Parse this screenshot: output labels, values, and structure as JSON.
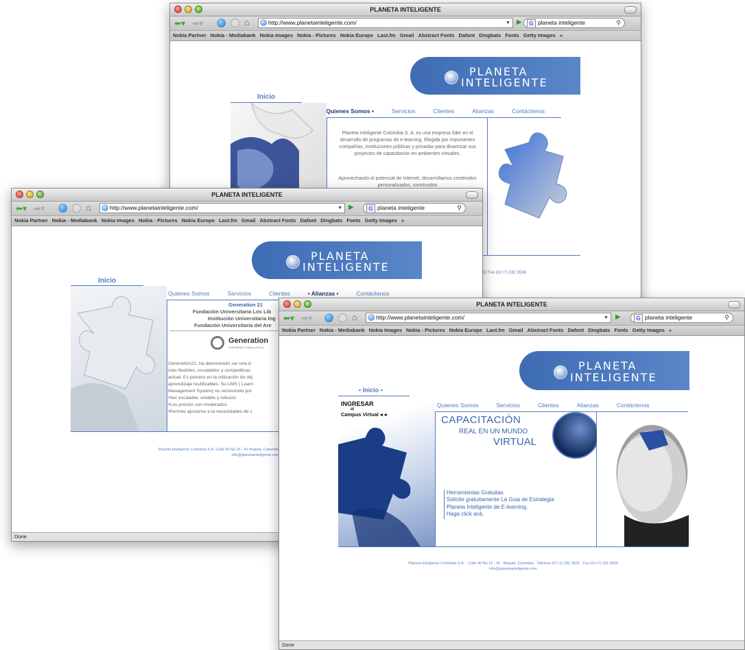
{
  "browser": {
    "window_title": "PLANETA INTELIGENTE",
    "url": "http://www.planetainteligente.com/",
    "search_text": "planeta inteligente",
    "status": "Done",
    "bookmarks": [
      "Nokia Partner",
      "Nokia - Mediabank",
      "Nokia Images",
      "Nokia - Pictures",
      "Nokia Europe",
      "Last.fm",
      "Gmail",
      "Abstract Fonts",
      "Dafont",
      "Dingbats",
      "Fonts",
      "Getty Images"
    ],
    "bookmarks_overflow": "»"
  },
  "site": {
    "logo_line1": "PLANETA",
    "logo_line2": "NTELIGENTE",
    "logo_initial": "I",
    "tab_inicio": "Inicio",
    "tab_inicio_active": "• Inicio •",
    "nav": [
      "Quienes Somos",
      "Servicios",
      "Clientes",
      "Alianzas",
      "Contáctenos"
    ],
    "nav_quienes_active": "• Quienes Somos •",
    "nav_alianzas_active": "• Alianzas •",
    "footer_company": "Planeta Inteligente Colombia S.A.",
    "footer_address": "Calle 40 No 15 - 41",
    "footer_city": "Bogotá, Colombia",
    "footer_phone": "Teléfono (57+1) 332 3532",
    "footer_fax": "Fax (51+7) 332 3536",
    "footer_email": "info@planetainteligente.com"
  },
  "window_top": {
    "paragraph1": "Planeta Inteligente Colombia S. A. es una empresa líder en el desarrollo de programas de e-learning. Elegida por importantes compañías, instituciones públicas y privadas para dinamizar sus proyectos de capacitación en ambientes virtuales.",
    "paragraph2": "Aprovechando el potencial de Internet, desarrollamos contenidos personalizados, construidos",
    "footer_partial": "3532   Fax (51+7) 332 3536"
  },
  "window_middle": {
    "list_title": "Generation 21",
    "list": [
      "Fundación Universitaria Los Lib",
      "Institución Universitaria Ing",
      "Fundación Universitaria del Are"
    ],
    "brand": "Generation",
    "brand_sub": "A Worldwide Learning Group",
    "body": [
      "Generation21, ha demostrado ser una d",
      "más flexibles, escalables y competitivas",
      "actual. Es pionero en la utilización de obj",
      "aprendizaje reutilizables. Su LMS ( Learn",
      "Management System) es reconocido por",
      "•Ser escalable, estable y robusto",
      "•Los precios son moderados",
      "•Permite ajustarse a la necesidades de c"
    ],
    "footer_line1": "Planeta Inteligente Colombia S.A.   Calle 40 No 15 - 41   Bogotá, Colombia",
    "footer_line2": "info@planetainteligente.com"
  },
  "window_front": {
    "ingresar": "INGRESAR",
    "al": "al",
    "campus": "Campus Virtual",
    "campus_arrows": "◂ ◂",
    "headline1": "CAPACITACIÓN",
    "headline2": "REAL EN UN MUNDO",
    "headline3": "VIRTUAL",
    "links": [
      "Herramientas Gratuitas",
      "Solicite gratuitamente La Guia de Estrategia",
      "Planeta Inteligente de E-learning.",
      "Haga click acá."
    ]
  }
}
